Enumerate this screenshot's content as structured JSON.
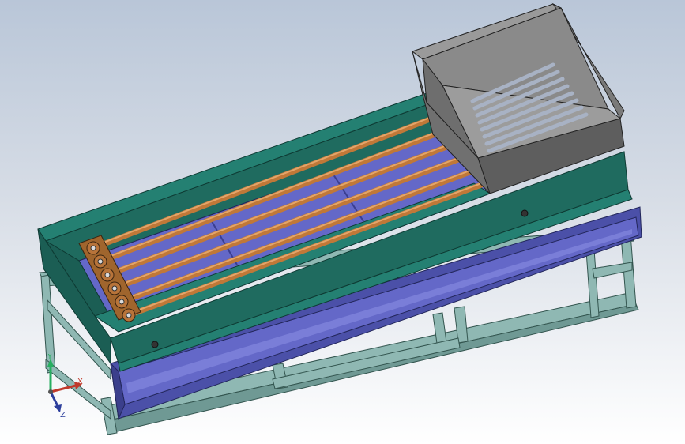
{
  "viewport": {
    "background_top": "#b9c6d8",
    "background_bottom": "#ffffff"
  },
  "model": {
    "frame_color": "#8fb8b3",
    "tray_color": "#5a5fb8",
    "trough_color": "#1f6b5f",
    "trough_top_color": "#248072",
    "trough_floor_color": "#6468c8",
    "pipe_color": "#c07838",
    "hopper_color": "#8a8a8a",
    "hopper_grate_color": "#a8b2c4",
    "pipe_count": 6
  },
  "triad": {
    "x_label": "X",
    "y_label": "Y",
    "z_label": "Z",
    "x_color": "#c0392b",
    "y_color": "#27ae60",
    "z_color": "#2c3e9c"
  }
}
